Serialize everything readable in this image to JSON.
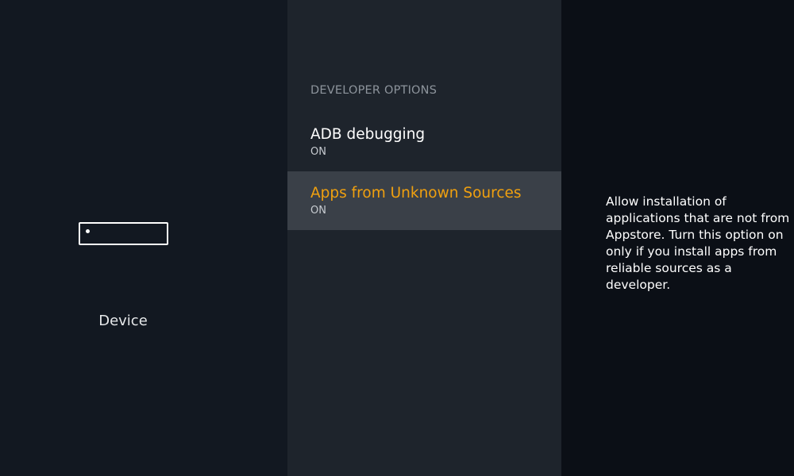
{
  "category": {
    "label": "Device",
    "icon": "device-icon"
  },
  "settings": {
    "section_title": "DEVELOPER OPTIONS",
    "items": [
      {
        "label": "ADB debugging",
        "value": "ON"
      },
      {
        "label": "Apps from Unknown Sources",
        "value": "ON"
      }
    ]
  },
  "details": {
    "description": "Allow installation of applications that are not from Appstore. Turn this option on only if you install apps from reliable sources as a developer."
  },
  "colors": {
    "highlight_text": "#f0a00f",
    "selected_row_bg": "#3a4048"
  }
}
